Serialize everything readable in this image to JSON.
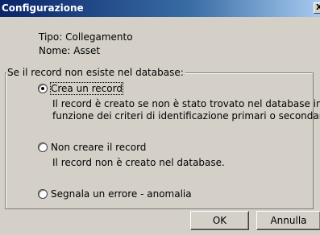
{
  "window": {
    "title": "Configurazione",
    "close_glyph": "X"
  },
  "info": {
    "tipo": "Tipo: Collegamento",
    "nome": "Nome: Asset"
  },
  "group": {
    "legend": "Se il record non esiste nel database:",
    "options": [
      {
        "label": "Crea un record",
        "selected": true,
        "description": [
          "Il record è creato se non è stato trovato nel database in",
          "funzione dei criteri di identificazione primari o secondari."
        ]
      },
      {
        "label": "Non creare il record",
        "selected": false,
        "description": [
          "Il record non è creato nel database."
        ]
      },
      {
        "label": "Segnala un errore - anomalia",
        "selected": false,
        "description": []
      }
    ]
  },
  "buttons": {
    "ok": "OK",
    "cancel": "Annulla"
  }
}
